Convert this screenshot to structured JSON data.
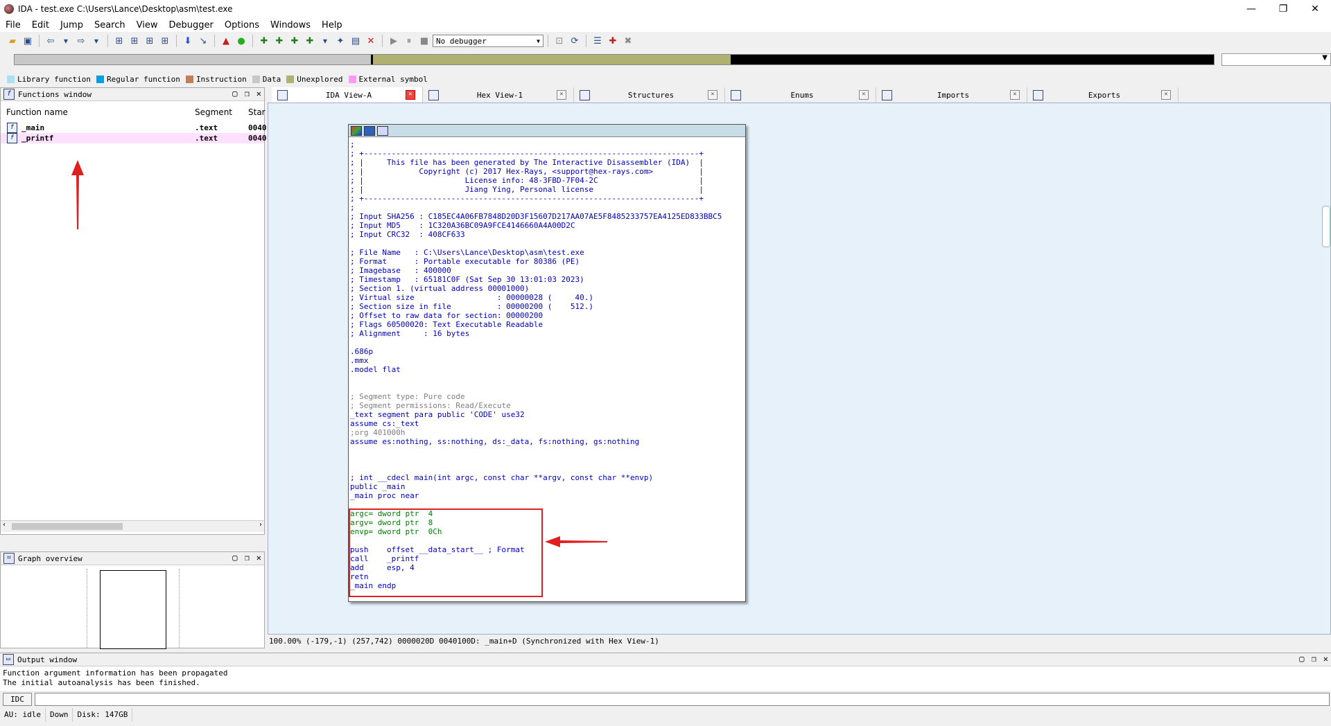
{
  "window": {
    "title": "IDA - test.exe C:\\Users\\Lance\\Desktop\\asm\\test.exe",
    "minimize": "—",
    "restore": "❐",
    "close": "✕"
  },
  "menu": [
    "File",
    "Edit",
    "Jump",
    "Search",
    "View",
    "Debugger",
    "Options",
    "Windows",
    "Help"
  ],
  "toolbar": {
    "debugger_select": "No debugger"
  },
  "colors": {
    "library": "#b0e0f0",
    "regular": "#00a0e8",
    "instruction": "#c08060",
    "data": "#c8c8c8",
    "unexplored": "#b0b070",
    "external": "#ff99ff",
    "code_blue": "#0000c0",
    "code_gray": "#808080",
    "code_green": "#008000",
    "highlight_red": "#e02020"
  },
  "legend": [
    {
      "label": "Library function",
      "color": "#b0e0f0"
    },
    {
      "label": "Regular function",
      "color": "#00a0e8"
    },
    {
      "label": "Instruction",
      "color": "#c08060"
    },
    {
      "label": "Data",
      "color": "#c8c8c8"
    },
    {
      "label": "Unexplored",
      "color": "#b0b070"
    },
    {
      "label": "External symbol",
      "color": "#ff99ff"
    }
  ],
  "functions_panel": {
    "title": "Functions window",
    "columns": [
      "Function name",
      "Segment",
      "Star"
    ],
    "rows": [
      {
        "name": "_main",
        "segment": ".text",
        "start": "0040"
      },
      {
        "name": "_printf",
        "segment": ".text",
        "start": "0040"
      }
    ]
  },
  "graph_panel": {
    "title": "Graph overview"
  },
  "tabs": [
    "IDA View-A",
    "Hex View-1",
    "Structures",
    "Enums",
    "Imports",
    "Exports"
  ],
  "code_lines": [
    {
      "t": ";",
      "c": "c-blue"
    },
    {
      "t": "; +-------------------------------------------------------------------------+",
      "c": "c-blue"
    },
    {
      "t": "; |     This file has been generated by The Interactive Disassembler (IDA)  |",
      "c": "c-blue"
    },
    {
      "t": "; |            Copyright (c) 2017 Hex-Rays, <support@hex-rays.com>          |",
      "c": "c-blue"
    },
    {
      "t": "; |                      License info: 48-3FBD-7F04-2C                      |",
      "c": "c-blue"
    },
    {
      "t": "; |                      Jiang Ying, Personal license                       |",
      "c": "c-blue"
    },
    {
      "t": "; +-------------------------------------------------------------------------+",
      "c": "c-blue"
    },
    {
      "t": ";",
      "c": "c-blue"
    },
    {
      "t": "; Input SHA256 : C185EC4A06FB7848D20D3F15607D217AA07AE5F8485233757EA4125ED833BBC5",
      "c": "c-blue"
    },
    {
      "t": "; Input MD5    : 1C320A36BC09A9FCE4146660A4A00D2C",
      "c": "c-blue"
    },
    {
      "t": "; Input CRC32  : 408CF633",
      "c": "c-blue"
    },
    {
      "t": "",
      "c": ""
    },
    {
      "t": "; File Name   : C:\\Users\\Lance\\Desktop\\asm\\test.exe",
      "c": "c-blue"
    },
    {
      "t": "; Format      : Portable executable for 80386 (PE)",
      "c": "c-blue"
    },
    {
      "t": "; Imagebase   : 400000",
      "c": "c-blue"
    },
    {
      "t": "; Timestamp   : 65181C0F (Sat Sep 30 13:01:03 2023)",
      "c": "c-blue"
    },
    {
      "t": "; Section 1. (virtual address 00001000)",
      "c": "c-blue"
    },
    {
      "t": "; Virtual size                  : 00000028 (     40.)",
      "c": "c-blue"
    },
    {
      "t": "; Section size in file          : 00000200 (    512.)",
      "c": "c-blue"
    },
    {
      "t": "; Offset to raw data for section: 00000200",
      "c": "c-blue"
    },
    {
      "t": "; Flags 60500020: Text Executable Readable",
      "c": "c-blue"
    },
    {
      "t": "; Alignment     : 16 bytes",
      "c": "c-blue"
    },
    {
      "t": "",
      "c": ""
    },
    {
      "t": ".686p",
      "c": "c-blue"
    },
    {
      "t": ".mmx",
      "c": "c-blue"
    },
    {
      "t": ".model flat",
      "c": "c-blue"
    },
    {
      "t": "",
      "c": ""
    },
    {
      "t": "",
      "c": ""
    },
    {
      "t": "; Segment type: Pure code",
      "c": "c-gray"
    },
    {
      "t": "; Segment permissions: Read/Execute",
      "c": "c-gray"
    },
    {
      "t": "_text segment para public 'CODE' use32",
      "c": "c-blue"
    },
    {
      "t": "assume cs:_text",
      "c": "c-blue"
    },
    {
      "t": ";org 401000h",
      "c": "c-gray"
    },
    {
      "t": "assume es:nothing, ss:nothing, ds:_data, fs:nothing, gs:nothing",
      "c": "c-blue"
    },
    {
      "t": "",
      "c": ""
    },
    {
      "t": "",
      "c": ""
    },
    {
      "t": "",
      "c": ""
    },
    {
      "t": "; int __cdecl main(int argc, const char **argv, const char **envp)",
      "c": "c-blue"
    },
    {
      "t": "public _main",
      "c": "c-blue"
    },
    {
      "t": "_main proc near",
      "c": "c-blue"
    },
    {
      "t": "",
      "c": ""
    },
    {
      "t": "argc= dword ptr  4",
      "c": "c-green"
    },
    {
      "t": "argv= dword ptr  8",
      "c": "c-green"
    },
    {
      "t": "envp= dword ptr  0Ch",
      "c": "c-green"
    },
    {
      "t": "",
      "c": ""
    },
    {
      "t": "push    offset __data_start__ ; Format",
      "c": "c-blue"
    },
    {
      "t": "call    _printf",
      "c": "c-blue"
    },
    {
      "t": "add     esp, 4",
      "c": "c-blue"
    },
    {
      "t": "retn",
      "c": "c-blue"
    },
    {
      "t": "_main endp",
      "c": "c-blue"
    }
  ],
  "main_status": "100.00% (-179,-1) (257,742) 0000020D 0040100D: _main+D (Synchronized with Hex View-1)",
  "output_panel": {
    "title": "Output window",
    "lines": [
      "Function argument information has been propagated",
      "The initial autoanalysis has been finished."
    ]
  },
  "cmd": {
    "button": "IDC"
  },
  "statusbar": [
    "AU:  idle",
    "Down",
    "Disk: 147GB"
  ]
}
